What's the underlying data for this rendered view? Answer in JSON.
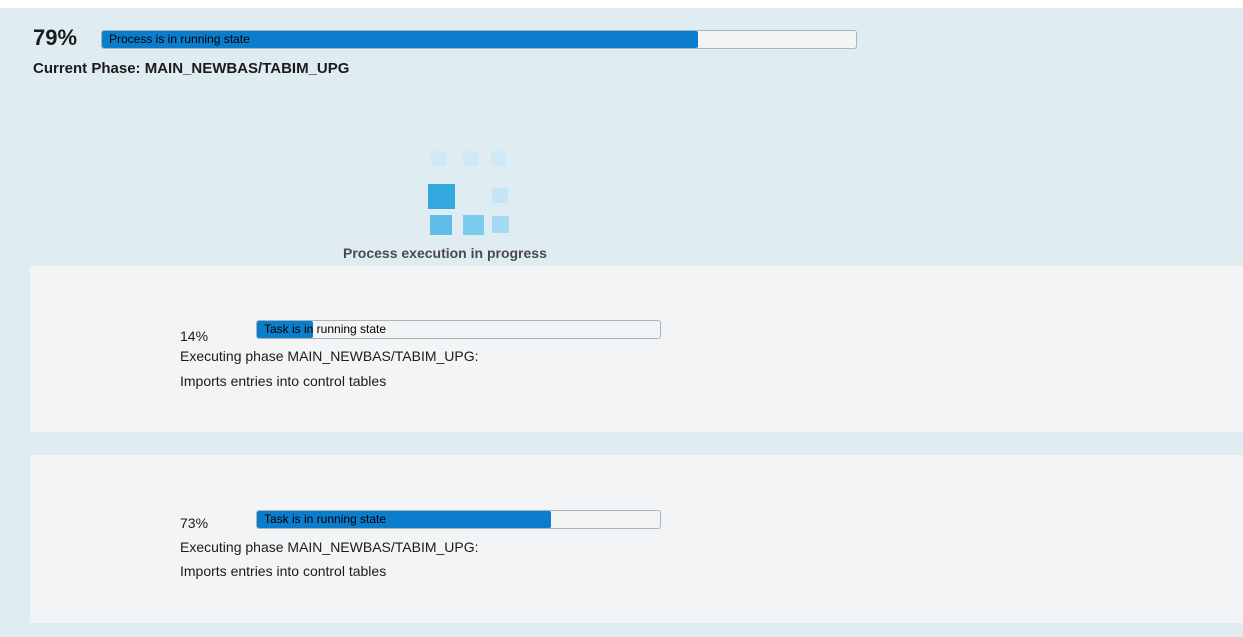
{
  "overall": {
    "percent_label": "79%",
    "progress": 0.79,
    "status": "Process is in running state",
    "current_phase": "Current Phase: MAIN_NEWBAS/TABIM_UPG"
  },
  "spinner": {
    "icon": "loading-squares-icon",
    "label": "Process execution in progress"
  },
  "tasks": [
    {
      "percent_label": "14%",
      "progress": 0.14,
      "status": "Task is in running state",
      "line1": "Executing phase MAIN_NEWBAS/TABIM_UPG:",
      "line2": "Imports entries into control tables"
    },
    {
      "percent_label": "73%",
      "progress": 0.73,
      "status": "Task is in running state",
      "line1": "Executing phase MAIN_NEWBAS/TABIM_UPG:",
      "line2": "Imports entries into control tables"
    }
  ],
  "colors": {
    "background": "#dfecf1",
    "panel": "#f2f4f5",
    "bar_fill": "#0b7dcc",
    "bar_track": "#f3f4f6",
    "spinner_dark": "#33a8de",
    "spinner_mid": "#62c1e8",
    "spinner_light": "#a9dcf3",
    "spinner_faint": "#c9e8f6"
  }
}
